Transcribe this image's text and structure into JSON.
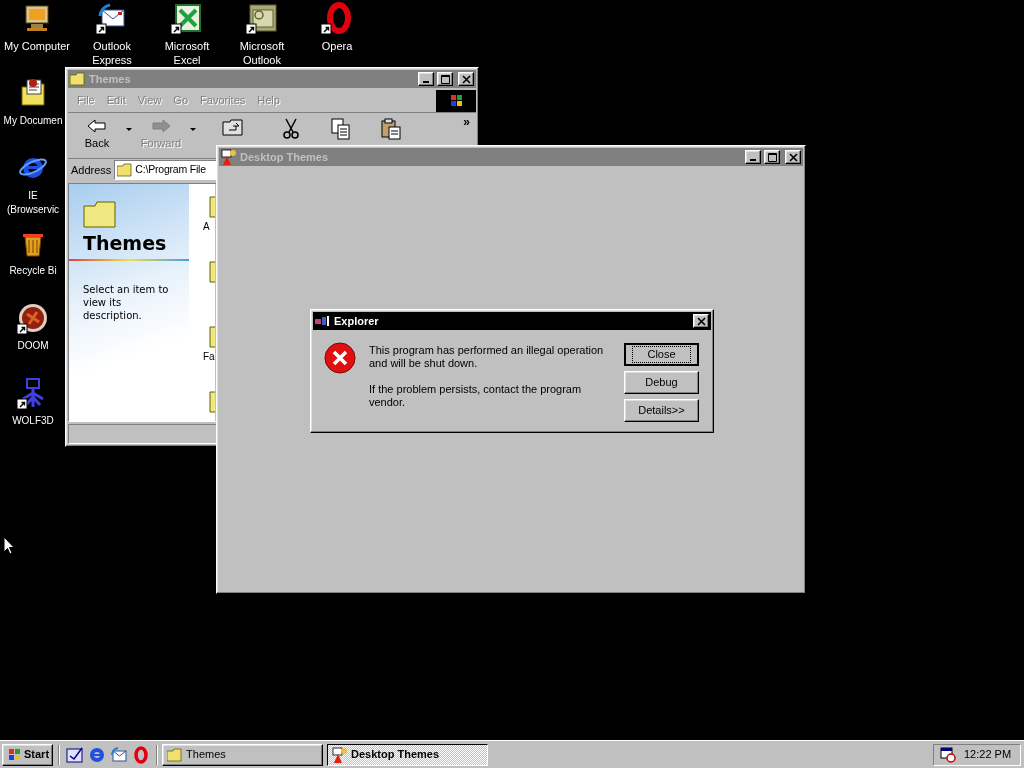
{
  "desktop": {
    "icons": [
      {
        "label": "My Computer",
        "kind": "computer",
        "shortcut": false
      },
      {
        "label": "Outlook Express",
        "kind": "mail",
        "shortcut": true
      },
      {
        "label": "Microsoft Excel",
        "kind": "sheet",
        "shortcut": true
      },
      {
        "label": "Microsoft Outlook",
        "kind": "calendar",
        "shortcut": true
      },
      {
        "label": "Opera",
        "kind": "ring",
        "shortcut": true
      },
      {
        "label": "My Documen",
        "kind": "documents",
        "shortcut": false
      },
      {
        "label": "IE (Browservic",
        "kind": "globe",
        "shortcut": false
      },
      {
        "label": "Recycle Bi",
        "kind": "bin",
        "shortcut": false
      },
      {
        "label": "DOOM",
        "kind": "disc",
        "shortcut": true
      },
      {
        "label": "WOLF3D",
        "kind": "emblem",
        "shortcut": true
      }
    ]
  },
  "themes_window": {
    "title": "Themes",
    "active": false,
    "controls": [
      {
        "kind": "minimize"
      },
      {
        "kind": "maximize"
      },
      {
        "kind": "close"
      }
    ],
    "menu": [
      {
        "label": "File",
        "disabled": true
      },
      {
        "label": "Edit",
        "disabled": true
      },
      {
        "label": "View",
        "disabled": true
      },
      {
        "label": "Go",
        "disabled": true
      },
      {
        "label": "Favorites",
        "disabled": true
      },
      {
        "label": "Help",
        "disabled": true
      }
    ],
    "toolbar": [
      {
        "kind": "back",
        "label": "Back",
        "disabled": false,
        "dropdown": true
      },
      {
        "kind": "forward",
        "label": "Forward",
        "disabled": true,
        "dropdown": true
      },
      {
        "kind": "up",
        "dropdown": false
      },
      {
        "kind": "cut",
        "dropdown": false
      },
      {
        "kind": "copy",
        "dropdown": false
      },
      {
        "kind": "paste",
        "dropdown": false
      }
    ],
    "toolbar_more": "»",
    "address_label": "Address",
    "address": "C:\\Program File",
    "sidebar": {
      "title": "Themes",
      "description": "Select an item to view its description."
    },
    "items": [
      {
        "kind": "folder",
        "label": "A"
      },
      {
        "kind": "folder"
      },
      {
        "kind": "folder",
        "label": "Fa"
      },
      {
        "kind": "folder"
      }
    ]
  },
  "desktop_themes_window": {
    "title": "Desktop Themes",
    "active": false,
    "controls": [
      {
        "kind": "minimize"
      },
      {
        "kind": "maximize"
      },
      {
        "kind": "close"
      }
    ]
  },
  "dialog": {
    "title": "Explorer",
    "active": true,
    "controls": [
      {
        "kind": "close"
      }
    ],
    "message": [
      "This program has performed an illegal operation and will be shut down.",
      "If the problem persists, contact the program vendor."
    ],
    "buttons": [
      {
        "label": "Close",
        "focused": true
      },
      {
        "label": "Debug",
        "focused": false
      },
      {
        "label": "Details>>",
        "focused": false
      }
    ]
  },
  "taskbar": {
    "start": "Start",
    "quick_launch": [
      {
        "kind": "desktop"
      },
      {
        "kind": "globe"
      },
      {
        "kind": "mail"
      },
      {
        "kind": "ring"
      }
    ],
    "tasks": [
      {
        "label": "Themes",
        "kind": "folder",
        "selected": false
      },
      {
        "label": "Desktop Themes",
        "kind": "themes",
        "selected": true
      }
    ],
    "clock": "12:22 PM"
  }
}
